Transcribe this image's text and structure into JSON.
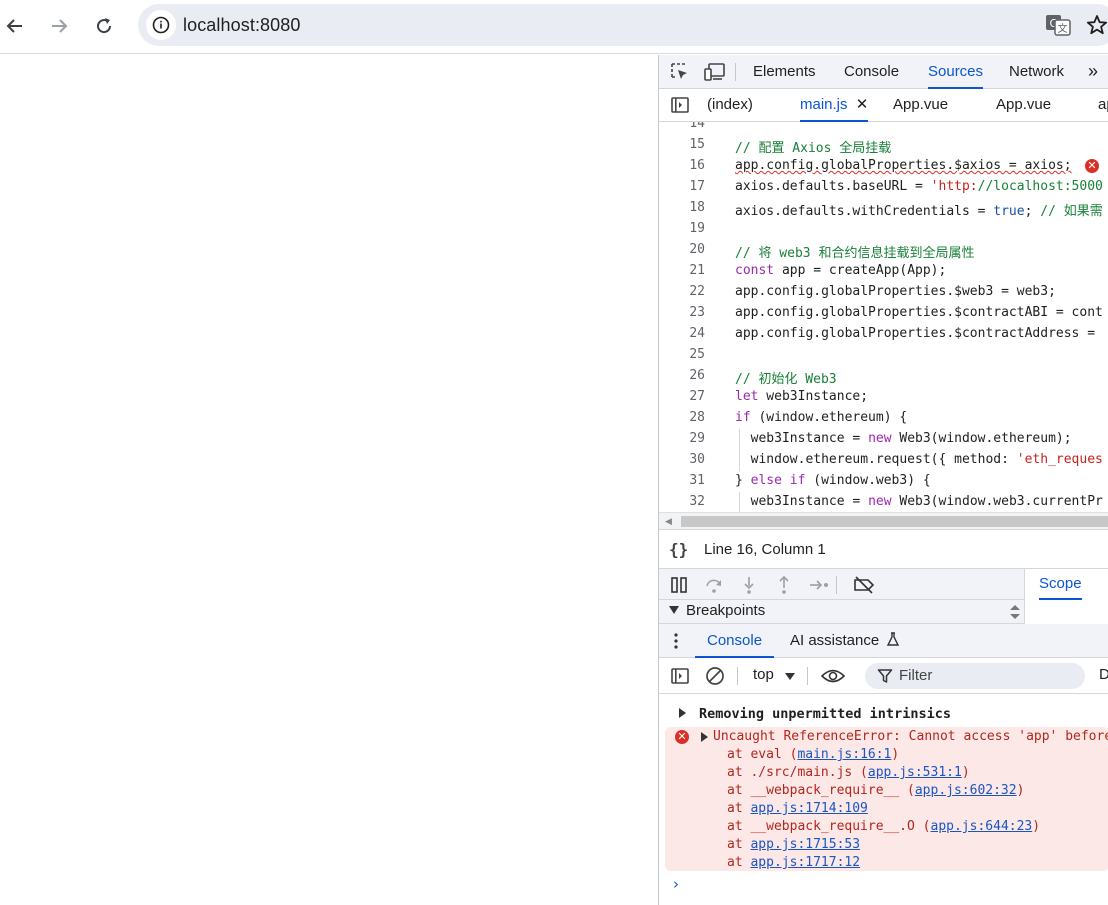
{
  "browser": {
    "url": "localhost:8080"
  },
  "devtools": {
    "tabs": [
      "Elements",
      "Console",
      "Sources",
      "Network"
    ],
    "active_tab": "Sources",
    "more_tabs_glyph": "»",
    "file_tabs": [
      "(index)",
      "main.js",
      "App.vue",
      "App.vue",
      "ap"
    ],
    "active_file": "main.js",
    "close_glyph": "✕",
    "code_lines": [
      {
        "n": "14",
        "t": ""
      },
      {
        "n": "15",
        "t": "// 配置 Axios 全局挂载"
      },
      {
        "n": "16",
        "t": "app.config.globalProperties.$axios = axios;"
      },
      {
        "n": "17",
        "t": "axios.defaults.baseURL = 'http://localhost:5000"
      },
      {
        "n": "18",
        "t": "axios.defaults.withCredentials = true; // 如果需"
      },
      {
        "n": "19",
        "t": ""
      },
      {
        "n": "20",
        "t": "// 将 web3 和合约信息挂载到全局属性"
      },
      {
        "n": "21",
        "t": "const app = createApp(App);"
      },
      {
        "n": "22",
        "t": "app.config.globalProperties.$web3 = web3;"
      },
      {
        "n": "23",
        "t": "app.config.globalProperties.$contractABI = cont"
      },
      {
        "n": "24",
        "t": "app.config.globalProperties.$contractAddress ="
      },
      {
        "n": "25",
        "t": ""
      },
      {
        "n": "26",
        "t": "// 初始化 Web3"
      },
      {
        "n": "27",
        "t": "let web3Instance;"
      },
      {
        "n": "28",
        "t": "if (window.ethereum) {"
      },
      {
        "n": "29",
        "t": "  web3Instance = new Web3(window.ethereum);"
      },
      {
        "n": "30",
        "t": "  window.ethereum.request({ method: 'eth_reques"
      },
      {
        "n": "31",
        "t": "} else if (window.web3) {"
      },
      {
        "n": "32",
        "t": "  web3Instance = new Web3(window.web3.currentPr"
      }
    ],
    "status": {
      "braces": "{}",
      "position": "Line 16, Column 1"
    },
    "scope_tab": "Scope",
    "breakpoints_label": "Breakpoints",
    "drawer_tabs": [
      "Console",
      "AI assistance"
    ],
    "console_toolbar": {
      "context": "top",
      "filter_placeholder": "Filter",
      "levels": "D"
    },
    "console": {
      "group_message": "Removing unpermitted intrinsics",
      "error_message": "Uncaught ReferenceError: Cannot access 'app' before",
      "stack": [
        {
          "prefix": "at eval (",
          "link": "main.js:16:1",
          "suffix": ")"
        },
        {
          "prefix": "at ./src/main.js (",
          "link": "app.js:531:1",
          "suffix": ")"
        },
        {
          "prefix": "at __webpack_require__ (",
          "link": "app.js:602:32",
          "suffix": ")"
        },
        {
          "prefix": "at ",
          "link": "app.js:1714:109",
          "suffix": ""
        },
        {
          "prefix": "at __webpack_require__.O (",
          "link": "app.js:644:23",
          "suffix": ")"
        },
        {
          "prefix": "at ",
          "link": "app.js:1715:53",
          "suffix": ""
        },
        {
          "prefix": "at ",
          "link": "app.js:1717:12",
          "suffix": ""
        }
      ],
      "prompt": "›"
    }
  },
  "colors": {
    "accent": "#0b57d0",
    "error": "#d93025",
    "error_bg": "#fce8e6",
    "comment": "#188038",
    "keyword": "#9c27b0",
    "string": "#c5221f"
  }
}
